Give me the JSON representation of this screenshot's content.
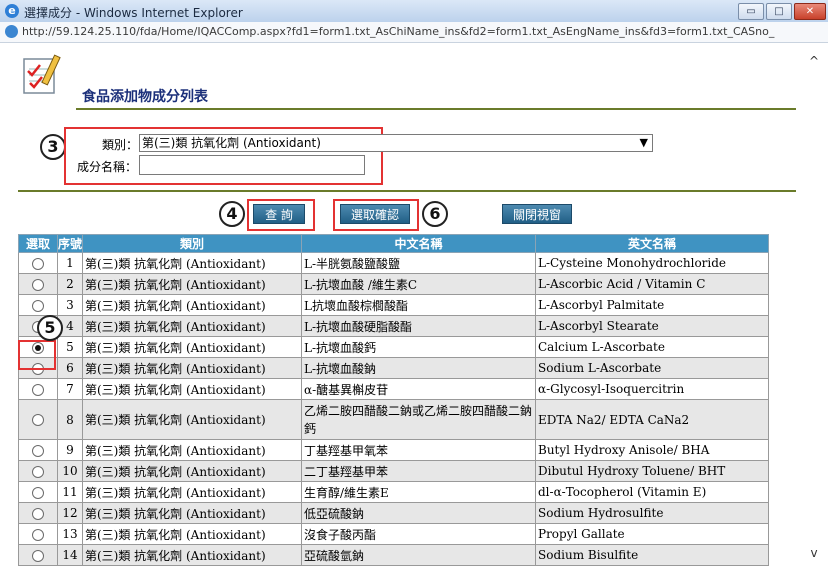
{
  "window": {
    "title": "選擇成分 - Windows Internet Explorer",
    "url": "http://59.124.25.110/fda/Home/IQACComp.aspx?fd1=form1.txt_AsChiName_ins&fd2=form1.txt_AsEngName_ins&fd3=form1.txt_CASno_",
    "min_label": "▭",
    "max_label": "□",
    "close_label": "✕"
  },
  "page": {
    "title": "食品添加物成分列表"
  },
  "form": {
    "category_label": "類別：",
    "category_value": "第(三)類 抗氧化劑 (Antioxidant)",
    "name_label": "成分名稱：",
    "name_value": ""
  },
  "buttons": {
    "search": "查 詢",
    "confirm": "選取確認",
    "close": "關閉視窗"
  },
  "steps": {
    "s3": "3",
    "s4": "4",
    "s5": "5",
    "s6": "6"
  },
  "table": {
    "headers": [
      "選取",
      "序號",
      "類別",
      "中文名稱",
      "英文名稱"
    ],
    "rows": [
      {
        "no": "1",
        "cat": "第(三)類 抗氧化劑 (Antioxidant)",
        "zh": "L-半胱氨酸鹽酸鹽",
        "en": "L-Cysteine Monohydrochloride",
        "checked": false
      },
      {
        "no": "2",
        "cat": "第(三)類 抗氧化劑 (Antioxidant)",
        "zh": "L-抗壞血酸 /維生素C",
        "en": "L-Ascorbic Acid / Vitamin C",
        "checked": false
      },
      {
        "no": "3",
        "cat": "第(三)類 抗氧化劑 (Antioxidant)",
        "zh": "L抗壞血酸棕櫚酸酯",
        "en": "L-Ascorbyl Palmitate",
        "checked": false
      },
      {
        "no": "4",
        "cat": "第(三)類 抗氧化劑 (Antioxidant)",
        "zh": "L-抗壞血酸硬脂酸酯",
        "en": "L-Ascorbyl Stearate",
        "checked": false
      },
      {
        "no": "5",
        "cat": "第(三)類 抗氧化劑 (Antioxidant)",
        "zh": "L-抗壞血酸鈣",
        "en": "Calcium L-Ascorbate",
        "checked": true
      },
      {
        "no": "6",
        "cat": "第(三)類 抗氧化劑 (Antioxidant)",
        "zh": "L-抗壞血酸鈉",
        "en": "Sodium L-Ascorbate",
        "checked": false
      },
      {
        "no": "7",
        "cat": "第(三)類 抗氧化劑 (Antioxidant)",
        "zh": "α-醣基異槲皮苷",
        "en": "α-Glycosyl-Isoquercitrin",
        "checked": false
      },
      {
        "no": "8",
        "cat": "第(三)類 抗氧化劑 (Antioxidant)",
        "zh": "乙烯二胺四醋酸二鈉或乙烯二胺四醋酸二鈉鈣",
        "en": "EDTA Na2/ EDTA CaNa2",
        "checked": false
      },
      {
        "no": "9",
        "cat": "第(三)類 抗氧化劑 (Antioxidant)",
        "zh": "丁基羥基甲氧苯",
        "en": "Butyl Hydroxy Anisole/ BHA",
        "checked": false
      },
      {
        "no": "10",
        "cat": "第(三)類 抗氧化劑 (Antioxidant)",
        "zh": "二丁基羥基甲苯",
        "en": "Dibutul Hydroxy Toluene/ BHT",
        "checked": false
      },
      {
        "no": "11",
        "cat": "第(三)類 抗氧化劑 (Antioxidant)",
        "zh": "生育醇/維生素E",
        "en": "dl-α-Tocopherol (Vitamin E)",
        "checked": false
      },
      {
        "no": "12",
        "cat": "第(三)類 抗氧化劑 (Antioxidant)",
        "zh": "低亞硫酸鈉",
        "en": "Sodium Hydrosulfite",
        "checked": false
      },
      {
        "no": "13",
        "cat": "第(三)類 抗氧化劑 (Antioxidant)",
        "zh": "沒食子酸丙酯",
        "en": "Propyl Gallate",
        "checked": false
      },
      {
        "no": "14",
        "cat": "第(三)類 抗氧化劑 (Antioxidant)",
        "zh": "亞硫酸氫鈉",
        "en": "Sodium Bisulfite",
        "checked": false
      }
    ]
  }
}
